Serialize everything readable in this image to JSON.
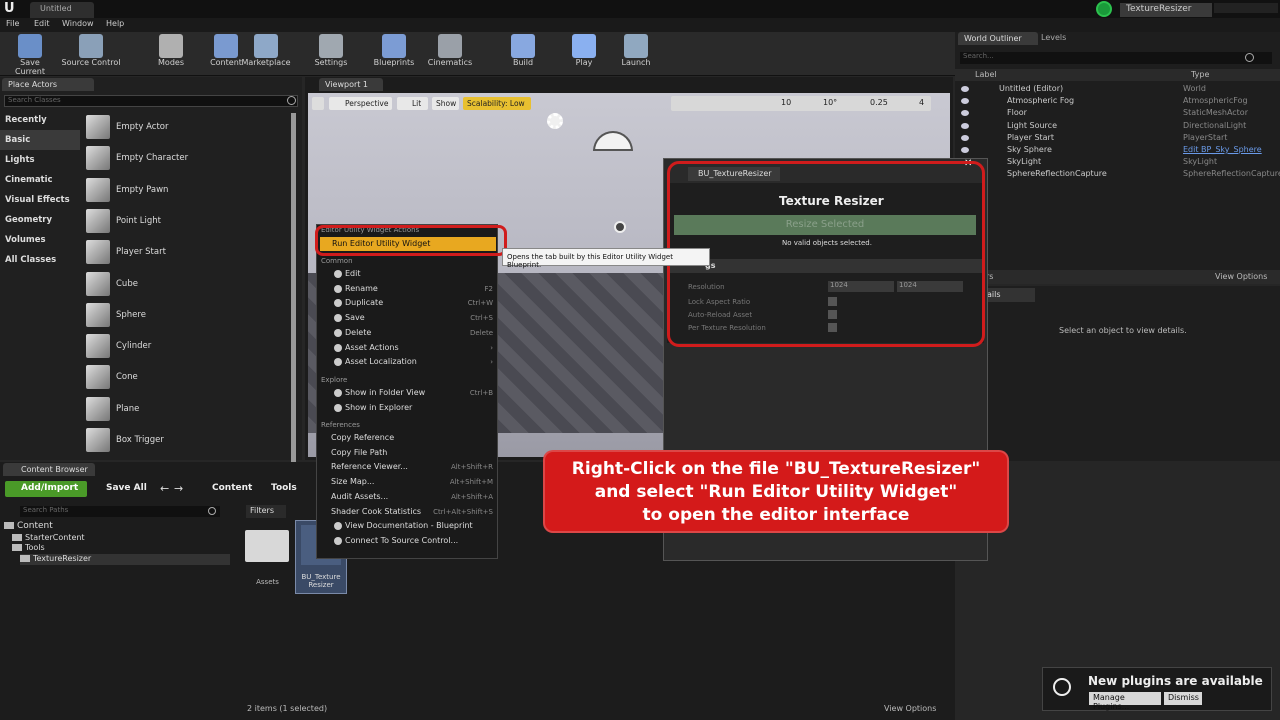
{
  "app": {
    "logo": "U",
    "tab_title": "Untitled",
    "project": "TextureResizer"
  },
  "menu": [
    "File",
    "Edit",
    "Window",
    "Help"
  ],
  "toolbar": [
    {
      "label": "Save Current",
      "icon": "save-icon",
      "color": "#6a8fc8"
    },
    {
      "label": "Source Control",
      "icon": "source-control-icon",
      "color": "#8aa0b8"
    },
    {
      "label": "Modes",
      "icon": "modes-icon",
      "color": "#b0b0b0"
    },
    {
      "label": "Content",
      "icon": "content-icon",
      "color": "#7a9ad0"
    },
    {
      "label": "Marketplace",
      "icon": "marketplace-icon",
      "color": "#8ea8c8"
    },
    {
      "label": "Settings",
      "icon": "settings-icon",
      "color": "#a0a8b0"
    },
    {
      "label": "Blueprints",
      "icon": "blueprints-icon",
      "color": "#7c9cd4"
    },
    {
      "label": "Cinematics",
      "icon": "cinematics-icon",
      "color": "#9aa0a8"
    },
    {
      "label": "Build",
      "icon": "build-icon",
      "color": "#88a8e0"
    },
    {
      "label": "Play",
      "icon": "play-icon",
      "color": "#8ab0f0"
    },
    {
      "label": "Launch",
      "icon": "launch-icon",
      "color": "#90a8c0"
    }
  ],
  "place_actors": {
    "tab": "Place Actors",
    "search_placeholder": "Search Classes",
    "categories": [
      "Recently Placed",
      "Basic",
      "Lights",
      "Cinematic",
      "Visual Effects",
      "Geometry",
      "Volumes",
      "All Classes"
    ],
    "selected_category": "Basic",
    "items": [
      "Empty Actor",
      "Empty Character",
      "Empty Pawn",
      "Point Light",
      "Player Start",
      "Cube",
      "Sphere",
      "Cylinder",
      "Cone",
      "Plane",
      "Box Trigger"
    ]
  },
  "viewport": {
    "tab": "Viewport 1",
    "perspective": "Perspective",
    "lit": "Lit",
    "show": "Show",
    "scalability": "Scalability: Low",
    "grid": "10",
    "rotation": "10°",
    "scale": "0.25",
    "cam": "4"
  },
  "context_menu": {
    "section1": "Editor Utility Widget Actions",
    "run": "Run Editor Utility Widget",
    "tooltip": "Opens the tab built by this Editor Utility Widget Blueprint.",
    "section_common": "Common",
    "common": [
      [
        "Edit",
        ""
      ],
      [
        "Rename",
        "F2"
      ],
      [
        "Duplicate",
        "Ctrl+W"
      ],
      [
        "Save",
        "Ctrl+S"
      ],
      [
        "Delete",
        "Delete"
      ],
      [
        "Asset Actions",
        "›"
      ],
      [
        "Asset Localization",
        "›"
      ]
    ],
    "section_explore": "Explore",
    "explore": [
      [
        "Show in Folder View",
        "Ctrl+B"
      ],
      [
        "Show in Explorer",
        ""
      ]
    ],
    "section_refs": "References",
    "refs": [
      [
        "Copy Reference",
        ""
      ],
      [
        "Copy File Path",
        ""
      ],
      [
        "Reference Viewer...",
        "Alt+Shift+R"
      ],
      [
        "Size Map...",
        "Alt+Shift+M"
      ],
      [
        "Audit Assets...",
        "Alt+Shift+A"
      ],
      [
        "Shader Cook Statistics",
        "Ctrl+Alt+Shift+S"
      ],
      [
        "View Documentation - Blueprint",
        ""
      ],
      [
        "Connect To Source Control...",
        ""
      ]
    ]
  },
  "widget": {
    "tab": "BU_TextureResizer",
    "title": "Texture Resizer",
    "button": "Resize Selected",
    "status": "No valid objects selected.",
    "settings_header": "gs",
    "rows": [
      {
        "label": "Resolution",
        "v1": "1024",
        "v2": "1024"
      },
      {
        "label": "Lock Aspect Ratio"
      },
      {
        "label": "Auto-Reload Asset"
      },
      {
        "label": "Per Texture Resolution"
      }
    ]
  },
  "outliner": {
    "tabs": [
      "World Outliner",
      "Levels"
    ],
    "search_placeholder": "Search...",
    "col_label": "Label",
    "col_type": "Type",
    "rows": [
      {
        "name": "Untitled (Editor)",
        "type": "World"
      },
      {
        "name": "Atmospheric Fog",
        "type": "AtmosphericFog"
      },
      {
        "name": "Floor",
        "type": "StaticMeshActor"
      },
      {
        "name": "Light Source",
        "type": "DirectionalLight"
      },
      {
        "name": "Player Start",
        "type": "PlayerStart"
      },
      {
        "name": "Sky Sphere",
        "type": "Edit BP_Sky_Sphere"
      },
      {
        "name": "SkyLight",
        "type": "SkyLight"
      },
      {
        "name": "SphereReflectionCapture",
        "type": "SphereReflectionCapture"
      }
    ],
    "actors_suffix": "rs",
    "view_options": "View Options"
  },
  "details": {
    "tab": "ails",
    "empty": "Select an object to view details."
  },
  "content_browser": {
    "tab": "Content Browser",
    "add_import": "Add/Import",
    "save_all": "Save All",
    "path": [
      "Content",
      "Tools"
    ],
    "search_paths": "Search Paths",
    "filters": "Filters",
    "tree": [
      "Content",
      "StarterContent",
      "Tools",
      "TextureResizer"
    ],
    "assets": [
      {
        "label": "Assets"
      },
      {
        "label": "BU_Texture Resizer"
      }
    ],
    "status": "2 items (1 selected)",
    "view_options": "View Options"
  },
  "callout": [
    "Right-Click on the file \"BU_TextureResizer\"",
    "and select \"Run Editor Utility Widget\"",
    "to open the editor interface"
  ],
  "notification": {
    "title": "New plugins are available",
    "manage": "Manage Plugins...",
    "dismiss": "Dismiss"
  },
  "colors": {
    "accent": "#e8b021",
    "highlight": "#d01c1c",
    "callout": "#d41a1a",
    "add_green": "#4a9a28"
  }
}
